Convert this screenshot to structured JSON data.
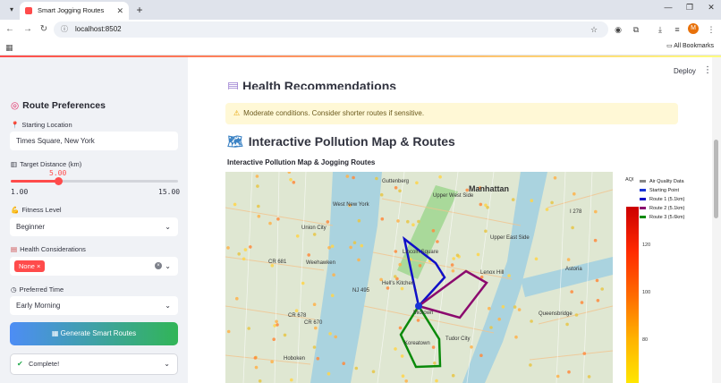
{
  "browser": {
    "tab_title": "Smart Jogging Routes",
    "new_tab": "+",
    "url": "localhost:8502",
    "avatar_letter": "M",
    "all_bookmarks": "All Bookmarks"
  },
  "sidebar": {
    "heading": "Route Preferences",
    "starting_location_label": "Starting Location",
    "starting_location_value": "Times Square, New York",
    "target_distance_label": "Target Distance (km)",
    "target_distance_value": "5.00",
    "target_distance_min": "1.00",
    "target_distance_max": "15.00",
    "target_distance_fraction": 0.286,
    "fitness_label": "Fitness Level",
    "fitness_value": "Beginner",
    "health_label": "Health Considerations",
    "health_chip": "None",
    "time_label": "Preferred Time",
    "time_value": "Early Morning",
    "generate_button": "Generate Smart Routes",
    "status_text": "Complete!"
  },
  "main": {
    "deploy": "Deploy",
    "health_heading": "Health Recommendations",
    "warning_text": "Moderate conditions. Consider shorter routes if sensitive.",
    "map_heading": "Interactive Pollution Map & Routes",
    "map_subheading": "Interactive Pollution Map & Jogging Routes"
  },
  "map": {
    "place_labels": [
      "Guttenberg",
      "Upper West Side",
      "Manhattan",
      "West New York",
      "Union City",
      "Upper East Side",
      "Weehawken",
      "Lincoln Square",
      "Hell's Kitchen",
      "Midtown",
      "Koreatown",
      "Tudor City",
      "Queensbridge",
      "Hoboken",
      "Astoria",
      "Lenox Hill",
      "NJ 495",
      "CR 681",
      "CR 678",
      "CR 670",
      "I 278"
    ]
  },
  "legend": {
    "aqi_label": "AQI",
    "items": [
      {
        "label": "Air Quality Data",
        "color": "#888888"
      },
      {
        "label": "Starting Point",
        "color": "#1a35d6"
      },
      {
        "label": "Route 1 (5.1km)",
        "color": "#1010c8"
      },
      {
        "label": "Route 2 (5.1km)",
        "color": "#8b0a6e"
      },
      {
        "label": "Route 3 (5.6km)",
        "color": "#0a8a0a"
      }
    ],
    "ticks": [
      "120",
      "100",
      "80"
    ]
  }
}
